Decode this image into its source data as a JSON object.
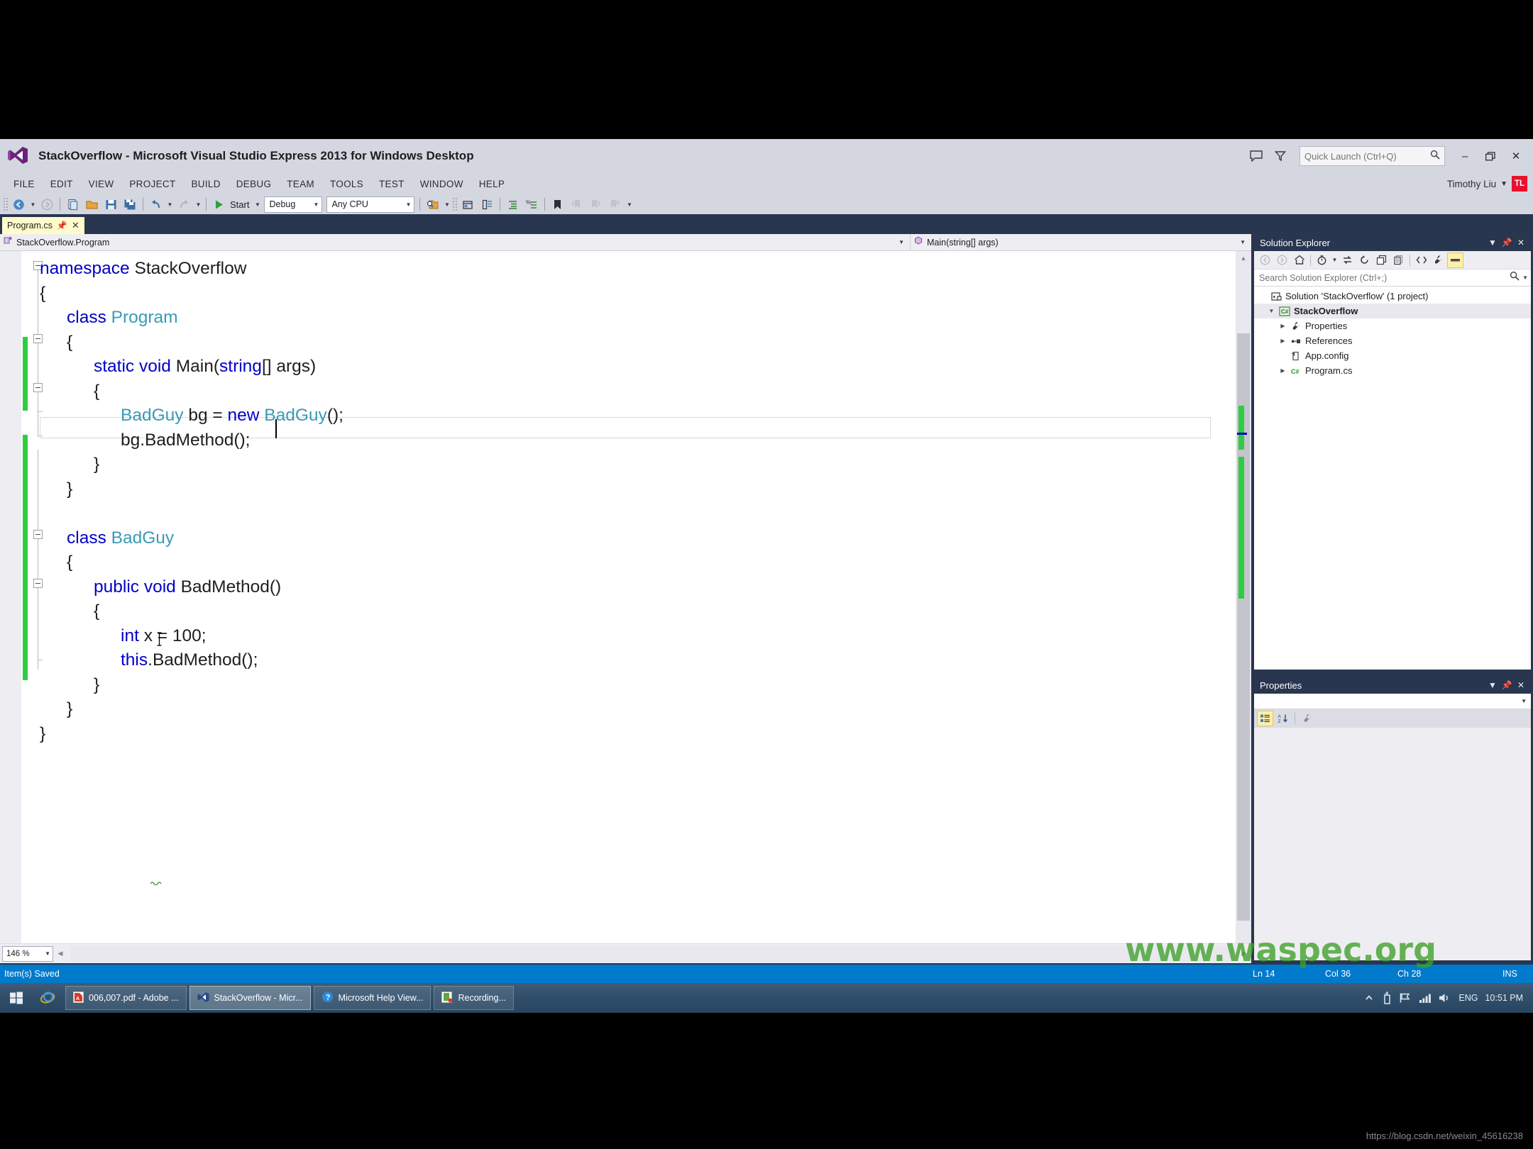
{
  "window": {
    "app_title": "StackOverflow - Microsoft Visual Studio Express 2013 for Windows Desktop",
    "logo_icon": "visual-studio-logo-icon",
    "feedback_icon": "feedback-icon",
    "filter_icon": "filter-icon",
    "quick_launch_placeholder": "Quick Launch (Ctrl+Q)",
    "search_icon": "search-icon",
    "minimize_label": "–",
    "restore_label": "❐",
    "close_label": "✕"
  },
  "menu": {
    "items": [
      {
        "label": "FILE"
      },
      {
        "label": "EDIT"
      },
      {
        "label": "VIEW"
      },
      {
        "label": "PROJECT"
      },
      {
        "label": "BUILD"
      },
      {
        "label": "DEBUG"
      },
      {
        "label": "TEAM"
      },
      {
        "label": "TOOLS"
      },
      {
        "label": "TEST"
      },
      {
        "label": "WINDOW"
      },
      {
        "label": "HELP"
      }
    ],
    "user_name": "Timothy Liu",
    "user_initials": "TL",
    "user_avatar_color": "#e8112d"
  },
  "toolbar": {
    "navigate_back_icon": "navigate-back-icon",
    "navigate_forward_icon": "navigate-forward-icon",
    "new_project_icon": "new-project-icon",
    "open_file_icon": "open-file-icon",
    "save_icon": "save-icon",
    "save_all_icon": "save-all-icon",
    "undo_icon": "undo-icon",
    "redo_icon": "redo-icon",
    "start_icon": "start-play-icon",
    "start_label": "Start",
    "config_value": "Debug",
    "platform_value": "Any CPU",
    "find_in_files_icon": "find-in-files-icon",
    "solution_explorer_icon": "solution-explorer-icon",
    "properties_window_icon": "properties-window-icon",
    "comment_icon": "comment-selection-icon",
    "uncomment_icon": "uncomment-selection-icon",
    "bookmark_icon": "bookmark-icon",
    "prev_bookmark_icon": "previous-bookmark-icon",
    "next_bookmark_icon": "next-bookmark-icon",
    "clear_bookmarks_icon": "clear-bookmarks-icon",
    "overflow_icon": "toolbar-overflow-icon"
  },
  "tabs": [
    {
      "label": "Program.cs",
      "pin_icon": "pin-icon",
      "close_icon": "close-icon",
      "active": true
    }
  ],
  "navbar": {
    "class_icon": "class-member-icon",
    "class_value": "StackOverflow.Program",
    "member_icon": "method-icon",
    "member_value": "Main(string[] args)",
    "dropdown_icon": "chevron-down-icon"
  },
  "editor": {
    "file": "Program.cs",
    "zoom_level": "146 %",
    "current_line_index": 7,
    "lines": [
      {
        "indent": 0,
        "outline": "collapse",
        "tokens": [
          {
            "t": "namespace ",
            "c": "kw"
          },
          {
            "t": "StackOverflow",
            "c": "pl"
          }
        ]
      },
      {
        "indent": 0,
        "outline": "",
        "tokens": [
          {
            "t": "{",
            "c": "pl"
          }
        ]
      },
      {
        "indent": 1,
        "outline": "collapse",
        "tokens": [
          {
            "t": "class ",
            "c": "kw"
          },
          {
            "t": "Program",
            "c": "ty"
          }
        ]
      },
      {
        "indent": 1,
        "outline": "",
        "tokens": [
          {
            "t": "{",
            "c": "pl"
          }
        ]
      },
      {
        "indent": 2,
        "outline": "collapse",
        "tokens": [
          {
            "t": "static void ",
            "c": "kw"
          },
          {
            "t": "Main(",
            "c": "pl"
          },
          {
            "t": "string",
            "c": "kw"
          },
          {
            "t": "[] args)",
            "c": "pl"
          }
        ]
      },
      {
        "indent": 2,
        "outline": "",
        "tokens": [
          {
            "t": "{",
            "c": "pl"
          }
        ]
      },
      {
        "indent": 3,
        "outline": "",
        "tokens": [
          {
            "t": "BadGuy",
            "c": "ty"
          },
          {
            "t": " bg = ",
            "c": "pl"
          },
          {
            "t": "new ",
            "c": "kw"
          },
          {
            "t": "BadGuy",
            "c": "ty"
          },
          {
            "t": "();",
            "c": "pl"
          }
        ]
      },
      {
        "indent": 3,
        "outline": "",
        "tokens": [
          {
            "t": "bg.BadMethod();",
            "c": "pl"
          }
        ]
      },
      {
        "indent": 2,
        "outline": "",
        "tokens": [
          {
            "t": "}",
            "c": "pl"
          }
        ]
      },
      {
        "indent": 1,
        "outline": "",
        "tokens": [
          {
            "t": "}",
            "c": "pl"
          }
        ]
      },
      {
        "indent": 0,
        "outline": "",
        "tokens": [
          {
            "t": "",
            "c": "pl"
          }
        ]
      },
      {
        "indent": 1,
        "outline": "collapse",
        "tokens": [
          {
            "t": "class ",
            "c": "kw"
          },
          {
            "t": "BadGuy",
            "c": "ty"
          }
        ]
      },
      {
        "indent": 1,
        "outline": "",
        "tokens": [
          {
            "t": "{",
            "c": "pl"
          }
        ]
      },
      {
        "indent": 2,
        "outline": "collapse",
        "tokens": [
          {
            "t": "public void ",
            "c": "kw"
          },
          {
            "t": "BadMethod()",
            "c": "pl"
          }
        ]
      },
      {
        "indent": 2,
        "outline": "",
        "tokens": [
          {
            "t": "{",
            "c": "pl"
          }
        ]
      },
      {
        "indent": 3,
        "outline": "",
        "tokens": [
          {
            "t": "int ",
            "c": "kw"
          },
          {
            "t": "x = 100;",
            "c": "pl"
          }
        ]
      },
      {
        "indent": 3,
        "outline": "",
        "tokens": [
          {
            "t": "this",
            "c": "kw"
          },
          {
            "t": ".BadMethod();",
            "c": "pl"
          }
        ]
      },
      {
        "indent": 2,
        "outline": "",
        "tokens": [
          {
            "t": "}",
            "c": "pl"
          }
        ]
      },
      {
        "indent": 1,
        "outline": "",
        "tokens": [
          {
            "t": "}",
            "c": "pl"
          }
        ]
      },
      {
        "indent": 0,
        "outline": "",
        "tokens": [
          {
            "t": "}",
            "c": "pl"
          }
        ]
      }
    ],
    "colors": {
      "keyword": "#0000c8",
      "type": "#3a9ab5",
      "plain": "#1e1e1e",
      "change_bar": "#2ecc40",
      "background": "#ffffff"
    },
    "scroll_up_icon": "scroll-up-icon",
    "scroll_down_icon": "scroll-down-icon",
    "scroll_left_icon": "scroll-left-icon",
    "scroll_right_icon": "scroll-right-icon",
    "split_icon": "split-editor-icon"
  },
  "solution_explorer": {
    "title": "Solution Explorer",
    "dropdown_icon": "chevron-down-icon",
    "pin_icon": "pin-icon",
    "close_icon": "close-icon",
    "toolbar": {
      "back_icon": "back-icon",
      "forward_icon": "forward-icon",
      "home_icon": "home-icon",
      "pending_changes_icon": "pending-changes-icon",
      "pending_changes_caret": "chevron-down-icon",
      "sync_icon": "sync-with-active-document-icon",
      "refresh_icon": "refresh-icon",
      "collapse_all_icon": "collapse-all-icon",
      "show_all_files_icon": "show-all-files-icon",
      "view_code_icon": "view-code-icon",
      "properties_icon": "properties-wrench-icon",
      "preview_icon": "preview-selected-items-icon"
    },
    "search_placeholder": "Search Solution Explorer (Ctrl+;)",
    "search_icon": "search-icon",
    "search_caret_icon": "chevron-down-icon",
    "tree": [
      {
        "label": "Solution 'StackOverflow' (1 project)",
        "icon": "solution-icon",
        "expander": "",
        "depth": 0,
        "bold": false,
        "selected": false
      },
      {
        "label": "StackOverflow",
        "icon": "csharp-project-icon",
        "expander": "expanded",
        "depth": 1,
        "bold": true,
        "selected": true
      },
      {
        "label": "Properties",
        "icon": "properties-wrench-icon",
        "expander": "collapsed",
        "depth": 2,
        "bold": false,
        "selected": false
      },
      {
        "label": "References",
        "icon": "references-icon",
        "expander": "collapsed",
        "depth": 2,
        "bold": false,
        "selected": false
      },
      {
        "label": "App.config",
        "icon": "config-file-icon",
        "expander": "",
        "depth": 2,
        "bold": false,
        "selected": false
      },
      {
        "label": "Program.cs",
        "icon": "csharp-file-icon",
        "expander": "collapsed",
        "depth": 2,
        "bold": false,
        "selected": false
      }
    ]
  },
  "properties_panel": {
    "title": "Properties",
    "dropdown_icon": "chevron-down-icon",
    "pin_icon": "pin-icon",
    "close_icon": "close-icon",
    "object_caret_icon": "chevron-down-icon",
    "categorized_icon": "categorized-view-icon",
    "alphabetical_icon": "alphabetical-sort-icon",
    "property_pages_icon": "property-pages-icon"
  },
  "statusbar": {
    "message": "Item(s) Saved",
    "line": "Ln 14",
    "column": "Col 36",
    "character": "Ch 28",
    "insert_mode": "INS",
    "background_color": "#007acc"
  },
  "watermark": "www.waspec.org",
  "bottom_url": "https://blog.csdn.net/weixin_45616238",
  "taskbar": {
    "start_icon": "windows-start-icon",
    "ie_icon": "internet-explorer-icon",
    "items": [
      {
        "label": "006,007.pdf - Adobe ...",
        "icon": "adobe-reader-icon",
        "active": false
      },
      {
        "label": "StackOverflow - Micr...",
        "icon": "visual-studio-icon",
        "active": true
      },
      {
        "label": "Microsoft Help View...",
        "icon": "help-viewer-icon",
        "active": false
      },
      {
        "label": "Recording...",
        "icon": "recording-icon",
        "active": false
      }
    ],
    "tray": {
      "show_hidden_icon": "show-hidden-icons-icon",
      "usb_icon": "usb-device-icon",
      "flag_icon": "action-center-flag-icon",
      "network_icon": "network-signal-icon",
      "volume_icon": "volume-icon",
      "language": "ENG",
      "clock": "10:51 PM"
    }
  }
}
